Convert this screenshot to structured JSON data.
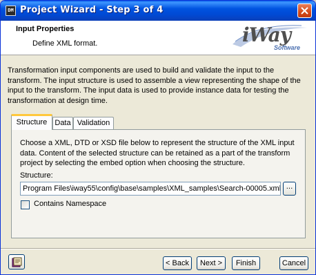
{
  "window": {
    "title": "Project Wizard - Step 3 of 4",
    "app_icon_label": "DM"
  },
  "header": {
    "title": "Input Properties",
    "subtitle": "Define XML format.",
    "logo_text": "iWay",
    "logo_sub": "Software"
  },
  "description": "Transformation input components are used to build and validate the input to the transform. The input structure is used to assemble a view representing the shape of the input to the transform. The input data is used to provide instance data for testing the transformation at design time.",
  "tabs": [
    {
      "label": "Structure",
      "active": true
    },
    {
      "label": "Data",
      "active": false
    },
    {
      "label": "Validation",
      "active": false
    }
  ],
  "structure_panel": {
    "description": "Choose a XML, DTD or XSD file below to represent the structure of the XML input data. Content of the selected structure can be retained as a part of the transform project by selecting the embed option when choosing the structure.",
    "structure_label": "Structure:",
    "structure_value": "Program Files\\iway55\\config\\base\\samples\\XML_samples\\Search-00005.xml",
    "browse_label": "...",
    "contains_namespace_label": "Contains Namespace",
    "contains_namespace_checked": false
  },
  "buttons": {
    "back": "< Back",
    "next": "Next >",
    "finish": "Finish",
    "cancel": "Cancel"
  },
  "colors": {
    "titlebar": "#0053e0",
    "active_tab_accent": "#ffc83c",
    "logo_blue": "#4a6fb0"
  }
}
